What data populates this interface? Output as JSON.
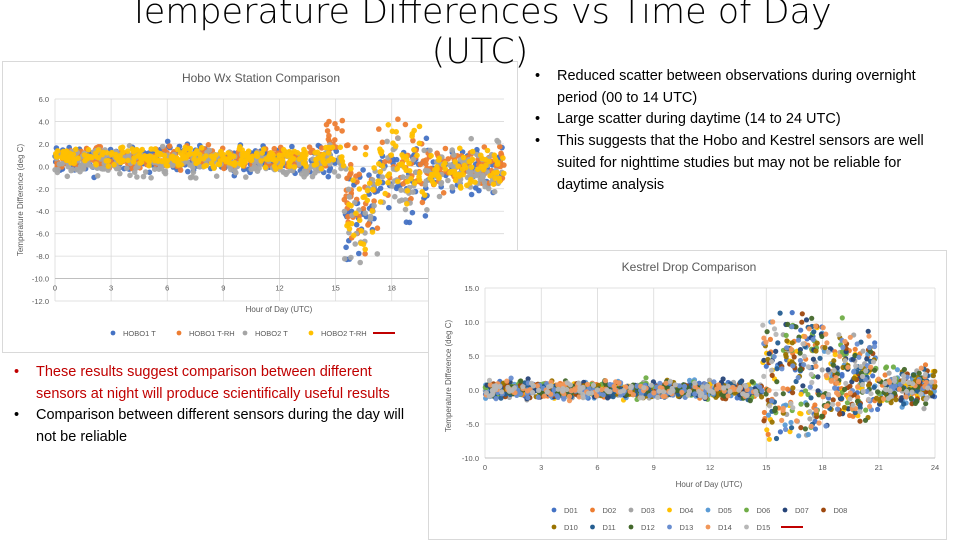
{
  "slide": {
    "title_line1": "Temperature Differences vs Time of Day",
    "title_line2": "(UTC)"
  },
  "bullets_right": [
    {
      "text": "Reduced scatter between observations during overnight period (00 to 14 UTC)",
      "color": "#000000"
    },
    {
      "text": "Large scatter during daytime (14 to 24 UTC)",
      "color": "#000000"
    },
    {
      "text": "This suggests that the Hobo and Kestrel sensors are well suited for nighttime studies but may not be reliable for daytime analysis",
      "color": "#000000"
    }
  ],
  "bullets_left": [
    {
      "text": "These results suggest  comparison between different sensors at night will produce scientifically useful results",
      "color": "#c00000"
    },
    {
      "text": "Comparison between different sensors during the day will not be reliable",
      "color": "#000000"
    }
  ],
  "bullet_glyph": "•",
  "chart_data": [
    {
      "id": "hobo",
      "type": "scatter",
      "title": "Hobo Wx Station Comparison",
      "xlabel": "Hour  of Day (UTC)",
      "ylabel": "Temperature  Difference (deg C)",
      "xlim": [
        0,
        24
      ],
      "ylim": [
        -12,
        6
      ],
      "xticks": [
        0,
        3,
        6,
        9,
        12,
        15,
        18
      ],
      "xtick_labels": [
        "0",
        "3",
        "6",
        "9",
        "12",
        "15",
        "18"
      ],
      "yticks": [
        6,
        4,
        2,
        0,
        -2,
        -4,
        -6,
        -8,
        -10,
        -12
      ],
      "ytick_labels": [
        "6.0",
        "4.0",
        "2.0",
        "0.0",
        "-2.0",
        "-4.0",
        "-6.0",
        "-8.0",
        "-10.0",
        "-12.0"
      ],
      "grid": true,
      "legend_position": "bottom",
      "trendline_color": "#c00000",
      "series": [
        {
          "name": "HOBO1 T",
          "color": "#4472c4",
          "profile": {
            "night_mean": 0.6,
            "night_spread": 1.0,
            "day_mean": -1.0,
            "day_spread": 2.8,
            "min": -10.5,
            "max": 2.5
          }
        },
        {
          "name": "HOBO1 T-RH",
          "color": "#ed7d31",
          "profile": {
            "night_mean": 0.7,
            "night_spread": 0.9,
            "day_mean": 0.5,
            "day_spread": 2.4,
            "min": -8.0,
            "max": 4.2
          }
        },
        {
          "name": "HOBO2 T",
          "color": "#a5a5a5",
          "profile": {
            "night_mean": 0.3,
            "night_spread": 1.1,
            "day_mean": -1.2,
            "day_spread": 2.6,
            "min": -9.5,
            "max": 2.5
          }
        },
        {
          "name": "HOBO2 T-RH",
          "color": "#ffc000",
          "profile": {
            "night_mean": 0.8,
            "night_spread": 0.8,
            "day_mean": 0.2,
            "day_spread": 2.5,
            "min": -9.0,
            "max": 3.7
          }
        }
      ],
      "legend": [
        {
          "label": "HOBO1 T",
          "color": "#4472c4",
          "kind": "marker"
        },
        {
          "label": "HOBO1 T-RH",
          "color": "#ed7d31",
          "kind": "marker"
        },
        {
          "label": "HOBO2 T",
          "color": "#a5a5a5",
          "kind": "marker"
        },
        {
          "label": "HOBO2 T-RH",
          "color": "#ffc000",
          "kind": "marker"
        },
        {
          "label": "",
          "color": "#c00000",
          "kind": "line"
        }
      ],
      "notes": "Overnight 0-14 UTC clustered near 0 to +1.5; 14-16 UTC orange HOBO1 T-RH points up to ~4; 15.5-17 UTC drops to ~-10; scatter -6 to +2 through 24 UTC"
    },
    {
      "id": "kestrel",
      "type": "scatter",
      "title": "Kestrel Drop Comparison",
      "xlabel": "Hour  of Day (UTC)",
      "ylabel": "Temperature  Difference (deg C)",
      "xlim": [
        0,
        24
      ],
      "ylim": [
        -10,
        15
      ],
      "xticks": [
        0,
        3,
        6,
        9,
        12,
        15,
        18,
        21,
        24
      ],
      "xtick_labels": [
        "0",
        "3",
        "6",
        "9",
        "12",
        "15",
        "18",
        "21",
        "24"
      ],
      "yticks": [
        15,
        10,
        5,
        0,
        -5,
        -10
      ],
      "ytick_labels": [
        "15.0",
        "10.0",
        "5.0",
        "0.0",
        "-5.0",
        "-10.0"
      ],
      "grid": true,
      "legend_position": "bottom",
      "trendline_color": "#c00000",
      "series": [
        {
          "name": "D01",
          "color": "#4472c4"
        },
        {
          "name": "D02",
          "color": "#ed7d31"
        },
        {
          "name": "D03",
          "color": "#a5a5a5"
        },
        {
          "name": "D04",
          "color": "#ffc000"
        },
        {
          "name": "D05",
          "color": "#5b9bd5"
        },
        {
          "name": "D06",
          "color": "#70ad47"
        },
        {
          "name": "D07",
          "color": "#264478"
        },
        {
          "name": "D08",
          "color": "#9e480e"
        },
        {
          "name": "D10",
          "color": "#997300"
        },
        {
          "name": "D11",
          "color": "#255e91"
        },
        {
          "name": "D12",
          "color": "#43682b"
        },
        {
          "name": "D13",
          "color": "#698ed0"
        },
        {
          "name": "D14",
          "color": "#f1975a"
        },
        {
          "name": "D15",
          "color": "#b7b7b7"
        }
      ],
      "profiles": {
        "night": {
          "mean": 0.0,
          "spread": 1.2,
          "min": -3.0,
          "max": 2.0
        },
        "day_high": {
          "hours": [
            14.8,
            18.2
          ],
          "max": 13.5
        },
        "day_low": {
          "hours": [
            15,
            21
          ],
          "min": -8.5
        },
        "late": {
          "hours": [
            21,
            24
          ],
          "mean": 0.5,
          "spread": 2.0
        }
      },
      "legend": [
        {
          "label": "D01",
          "color": "#4472c4",
          "kind": "marker"
        },
        {
          "label": "D02",
          "color": "#ed7d31",
          "kind": "marker"
        },
        {
          "label": "D03",
          "color": "#a5a5a5",
          "kind": "marker"
        },
        {
          "label": "D04",
          "color": "#ffc000",
          "kind": "marker"
        },
        {
          "label": "D05",
          "color": "#5b9bd5",
          "kind": "marker"
        },
        {
          "label": "D06",
          "color": "#70ad47",
          "kind": "marker"
        },
        {
          "label": "D07",
          "color": "#264478",
          "kind": "marker"
        },
        {
          "label": "D08",
          "color": "#9e480e",
          "kind": "marker"
        },
        {
          "label": "D10",
          "color": "#997300",
          "kind": "marker"
        },
        {
          "label": "D11",
          "color": "#255e91",
          "kind": "marker"
        },
        {
          "label": "D12",
          "color": "#43682b",
          "kind": "marker"
        },
        {
          "label": "D13",
          "color": "#698ed0",
          "kind": "marker"
        },
        {
          "label": "D14",
          "color": "#f1975a",
          "kind": "marker"
        },
        {
          "label": "D15",
          "color": "#b7b7b7",
          "kind": "marker"
        },
        {
          "label": "",
          "color": "#c00000",
          "kind": "line"
        }
      ]
    }
  ]
}
